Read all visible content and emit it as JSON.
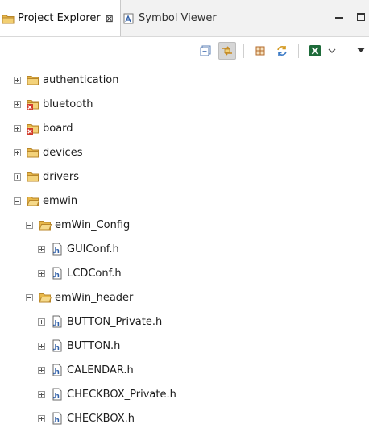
{
  "tabs": [
    {
      "label": "Project Explorer",
      "icon": "project-explorer-icon",
      "active": true
    },
    {
      "label": "Symbol Viewer",
      "icon": "symbol-viewer-icon",
      "active": false
    }
  ],
  "close_glyph": "⊠",
  "toolbar": {
    "buttons": [
      "collapse-all-icon",
      "link-with-editor-icon",
      "grid-icon",
      "sync-icon",
      "excel-icon",
      "dropdown-chevron-icon"
    ]
  },
  "colors": {
    "folder": "#e8b84a",
    "folder_dark": "#b8862a",
    "header_file_blue": "#2f5fa8",
    "error_red": "#d23a2a",
    "excel_green": "#1e6b3a"
  },
  "tree": [
    {
      "label": "authentication",
      "type": "folder",
      "level": 0,
      "expanded": false,
      "error": false
    },
    {
      "label": "bluetooth",
      "type": "folder",
      "level": 0,
      "expanded": false,
      "error": true
    },
    {
      "label": "board",
      "type": "folder",
      "level": 0,
      "expanded": false,
      "error": true
    },
    {
      "label": "devices",
      "type": "folder",
      "level": 0,
      "expanded": false,
      "error": false
    },
    {
      "label": "drivers",
      "type": "folder",
      "level": 0,
      "expanded": false,
      "error": false
    },
    {
      "label": "emwin",
      "type": "folder",
      "level": 0,
      "expanded": true,
      "error": false
    },
    {
      "label": "emWin_Config",
      "type": "folder",
      "level": 1,
      "expanded": true,
      "error": false
    },
    {
      "label": "GUIConf.h",
      "type": "header",
      "level": 2,
      "expanded": false,
      "error": false
    },
    {
      "label": "LCDConf.h",
      "type": "header",
      "level": 2,
      "expanded": false,
      "error": false
    },
    {
      "label": "emWin_header",
      "type": "folder",
      "level": 1,
      "expanded": true,
      "error": false
    },
    {
      "label": "BUTTON_Private.h",
      "type": "header",
      "level": 2,
      "expanded": false,
      "error": false
    },
    {
      "label": "BUTTON.h",
      "type": "header",
      "level": 2,
      "expanded": false,
      "error": false
    },
    {
      "label": "CALENDAR.h",
      "type": "header",
      "level": 2,
      "expanded": false,
      "error": false
    },
    {
      "label": "CHECKBOX_Private.h",
      "type": "header",
      "level": 2,
      "expanded": false,
      "error": false
    },
    {
      "label": "CHECKBOX.h",
      "type": "header",
      "level": 2,
      "expanded": false,
      "error": false
    }
  ]
}
